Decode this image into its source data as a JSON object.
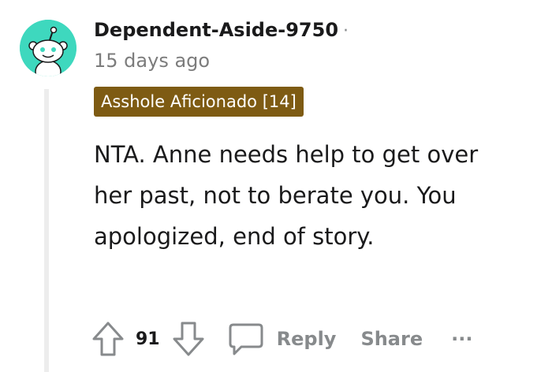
{
  "comment": {
    "author": "Dependent-Aside-9750",
    "separator": "·",
    "timestamp": "15 days ago",
    "flair": "Asshole Aficionado [14]",
    "body": "NTA. Anne needs help to get over her past, not to berate you. You apologized, end of story."
  },
  "actions": {
    "score": "91",
    "reply_label": "Reply",
    "share_label": "Share",
    "more_label": "···"
  },
  "colors": {
    "avatar_bg": "#3ed8be",
    "flair_bg": "#7e5b13",
    "muted": "#878a8c"
  }
}
